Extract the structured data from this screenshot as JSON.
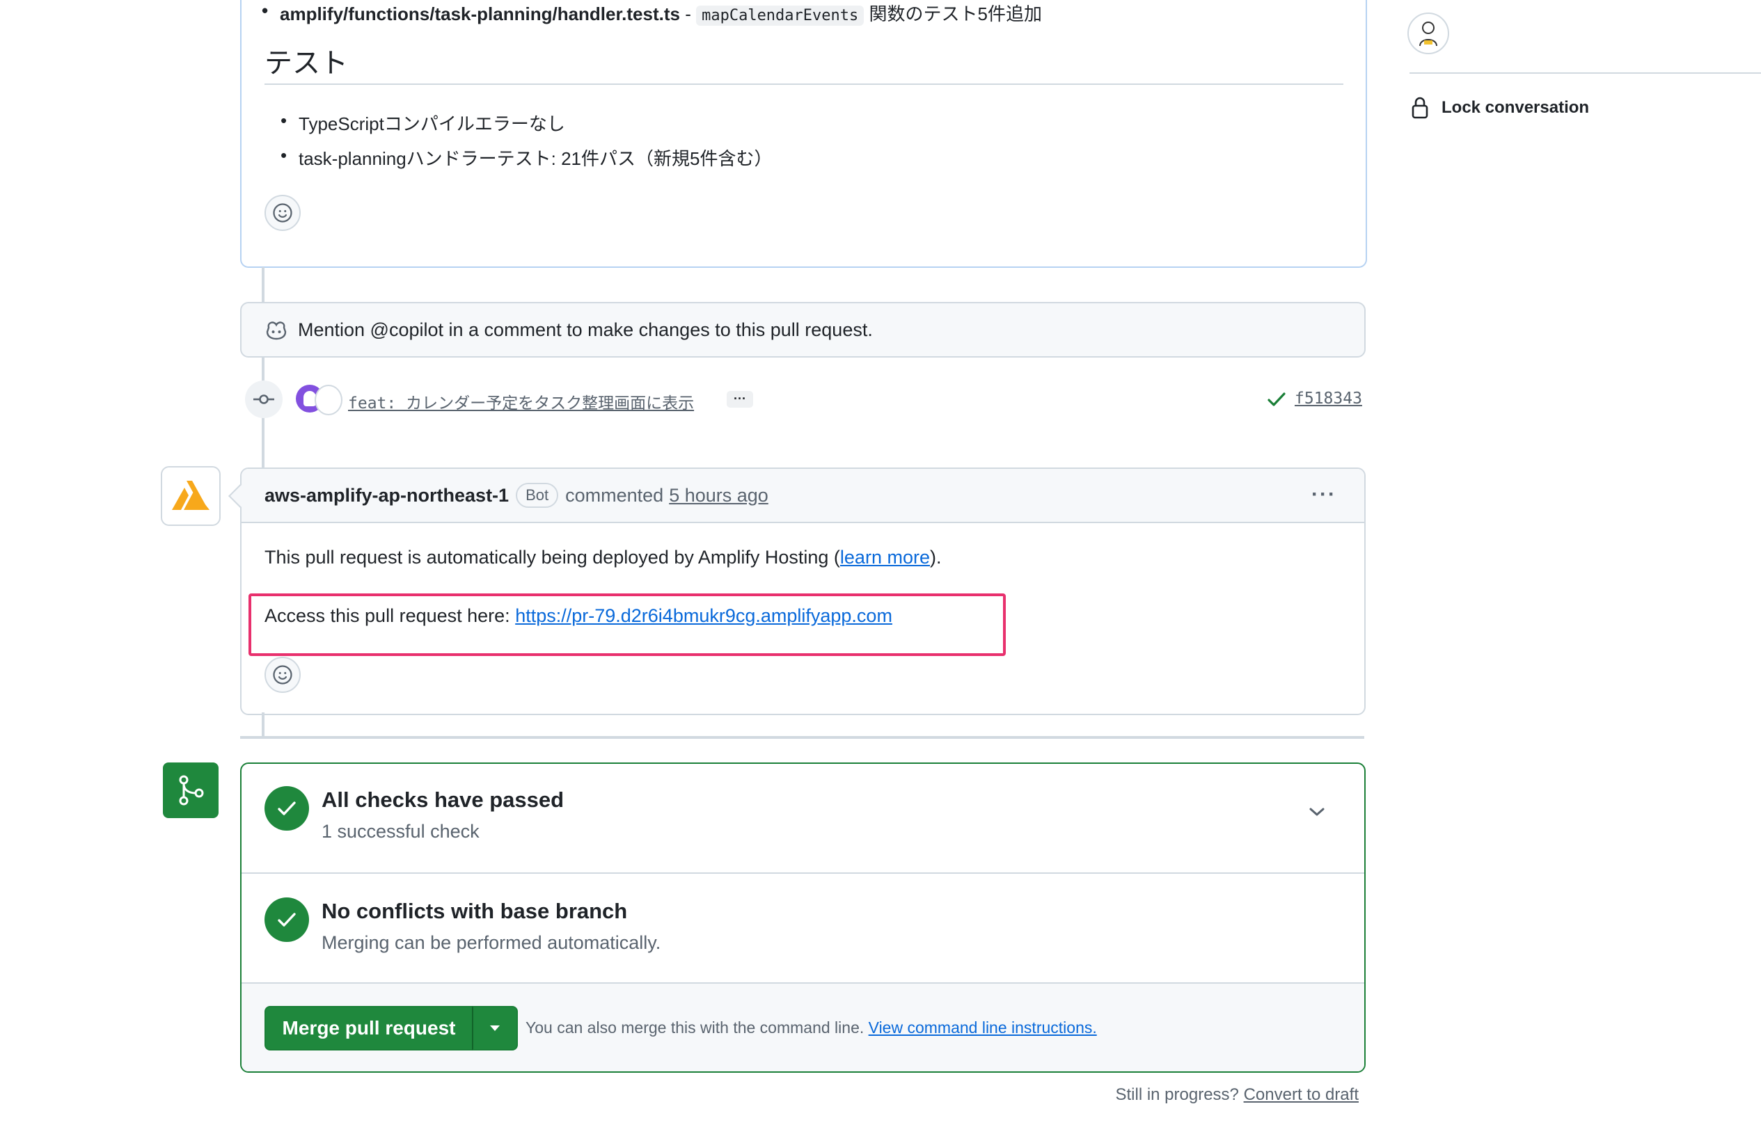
{
  "description": {
    "file_line": {
      "path": "amplify/functions/task-planning/handler.test.ts",
      "separator": " - ",
      "code": "mapCalendarEvents",
      "suffix": " 関数のテスト5件追加"
    },
    "heading": "テスト",
    "bullets": [
      "TypeScriptコンパイルエラーなし",
      "task-planningハンドラーテスト: 21件パス（新規5件含む）"
    ]
  },
  "copilot_notice": "Mention @copilot in a comment to make changes to this pull request.",
  "commit": {
    "message": "feat: カレンダー予定をタスク整理画面に表示",
    "more": "···",
    "sha": "f518343"
  },
  "comment": {
    "author": "aws-amplify-ap-northeast-1",
    "badge": "Bot",
    "action": "commented",
    "time": "5 hours ago",
    "body_prefix": "This pull request is automatically being deployed by Amplify Hosting (",
    "body_link": "learn more",
    "body_suffix": ").",
    "access_label": "Access this pull request here: ",
    "access_url": "https://pr-79.d2r6i4bmukr9cg.amplifyapp.com"
  },
  "merge_box": {
    "checks_title": "All checks have passed",
    "checks_sub": "1 successful check",
    "conflicts_title": "No conflicts with base branch",
    "conflicts_sub": "Merging can be performed automatically.",
    "merge_button": "Merge pull request",
    "cli_text": "You can also merge this with the command line.",
    "cli_link": "View command line instructions."
  },
  "footer": {
    "prefix": "Still in progress?",
    "link": "Convert to draft"
  },
  "sidebar": {
    "lock_label": "Lock conversation"
  },
  "colors": {
    "green": "#1f883d",
    "link": "#0969da",
    "highlight": "#e8306d",
    "amplify": "#f7a81b"
  }
}
